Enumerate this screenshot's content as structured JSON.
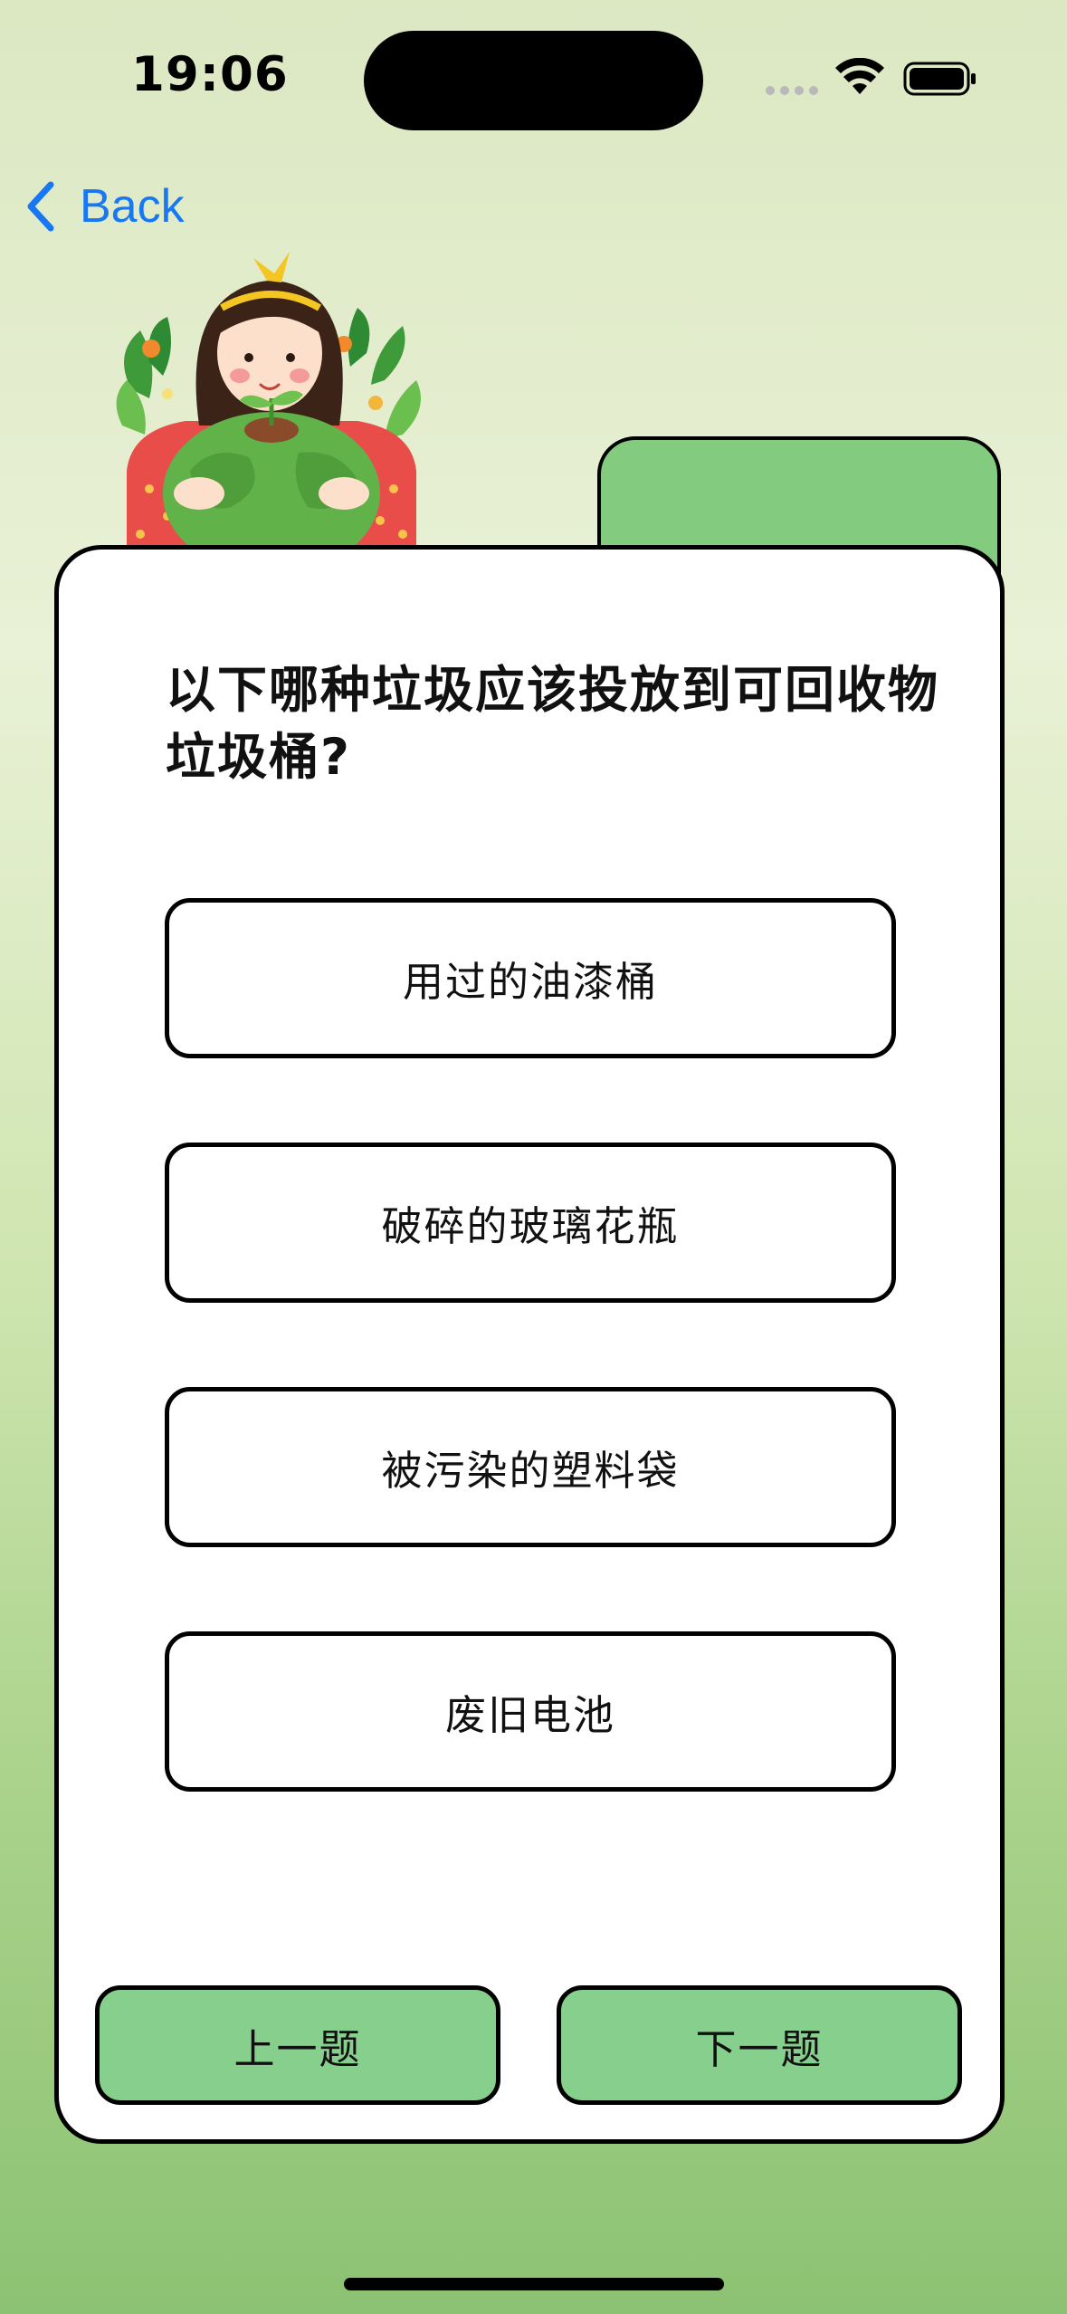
{
  "status_bar": {
    "time": "19:06"
  },
  "navigation": {
    "back_label": "Back"
  },
  "quiz": {
    "question": "以下哪种垃圾应该投放到可回收物垃圾桶?",
    "options": [
      {
        "label": "用过的油漆桶"
      },
      {
        "label": "破碎的玻璃花瓶"
      },
      {
        "label": "被污染的塑料袋"
      },
      {
        "label": "废旧电池"
      }
    ],
    "prev_label": "上一题",
    "next_label": "下一题"
  },
  "colors": {
    "accent_green": "#86cf8c",
    "link_blue": "#1877f2"
  },
  "icons": [
    "wifi-icon",
    "battery-icon",
    "chevron-left-icon",
    "girl-hugging-earth-illustration"
  ]
}
